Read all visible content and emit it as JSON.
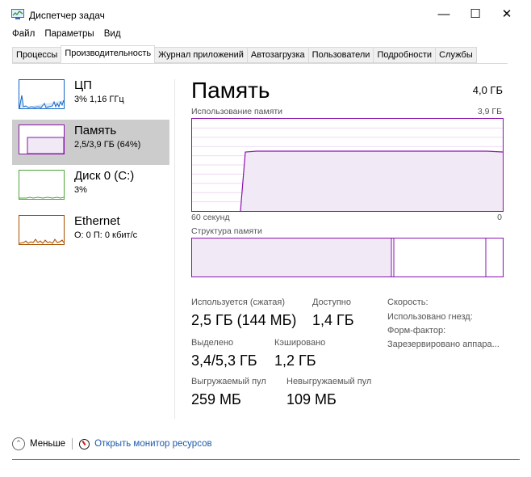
{
  "window": {
    "title": "Диспетчер задач",
    "controls": {
      "minimize": "—",
      "maximize": "☐",
      "close": "✕"
    }
  },
  "menu": {
    "items": [
      "Файл",
      "Параметры",
      "Вид"
    ]
  },
  "tabs": [
    {
      "label": "Процессы",
      "active": false
    },
    {
      "label": "Производительность",
      "active": true
    },
    {
      "label": "Журнал приложений",
      "active": false
    },
    {
      "label": "Автозагрузка",
      "active": false
    },
    {
      "label": "Пользователи",
      "active": false
    },
    {
      "label": "Подробности",
      "active": false
    },
    {
      "label": "Службы",
      "active": false
    }
  ],
  "sidebar": {
    "items": [
      {
        "title": "ЦП",
        "sub": "3% 1,16 ГГц",
        "color": "#1166c8",
        "selected": false
      },
      {
        "title": "Память",
        "sub": "2,5/3,9 ГБ (64%)",
        "color": "#8b12ae",
        "selected": true
      },
      {
        "title": "Диск 0 (C:)",
        "sub": "3%",
        "color": "#4da63a",
        "selected": false
      },
      {
        "title": "Ethernet",
        "sub": "О: 0 П: 0 кбит/с",
        "color": "#a74f01",
        "selected": false
      }
    ]
  },
  "main": {
    "title": "Память",
    "capacity": "4,0 ГБ",
    "usage_label": "Использование памяти",
    "usage_max": "3,9 ГБ",
    "time_left": "60 секунд",
    "time_right": "0",
    "composition_label": "Структура памяти",
    "accent": "#8b12ae",
    "fill": "#f1e9f5",
    "usage_fraction": 0.64
  },
  "stats": {
    "in_use_label": "Используется (сжатая)",
    "in_use_value": "2,5 ГБ (144 МБ)",
    "available_label": "Доступно",
    "available_value": "1,4 ГБ",
    "committed_label": "Выделено",
    "committed_value": "3,4/5,3 ГБ",
    "cached_label": "Кэшировано",
    "cached_value": "1,2 ГБ",
    "paged_label": "Выгружаемый пул",
    "paged_value": "259 МБ",
    "nonpaged_label": "Невыгружаемый пул",
    "nonpaged_value": "109 МБ",
    "speed_label": "Скорость:",
    "slots_label": "Использовано гнезд:",
    "form_label": "Форм-фактор:",
    "reserved_label": "Зарезервировано аппара..."
  },
  "bottom": {
    "less_label": "Меньше",
    "monitor_label": "Открыть монитор ресурсов"
  }
}
